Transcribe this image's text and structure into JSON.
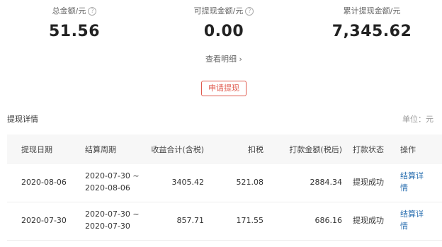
{
  "summary": {
    "total": {
      "label": "总金额/元",
      "value": "51.56"
    },
    "withdrawable": {
      "label": "可提现金额/元",
      "value": "0.00"
    },
    "cumulative": {
      "label": "累计提现金额/元",
      "value": "7,345.62"
    },
    "help_symbol": "?"
  },
  "detail_link": "查看明细 ›",
  "apply_button": "申请提现",
  "section": {
    "title": "提现详情",
    "unit": "单位：元"
  },
  "table": {
    "headers": [
      "提现日期",
      "结算周期",
      "收益合计(含税)",
      "扣税",
      "打款金额(税后)",
      "打款状态",
      "操作"
    ],
    "rows": [
      {
        "date": "2020-08-06",
        "period_start": "2020-07-30 ~",
        "period_end": "2020-08-06",
        "income": "3405.42",
        "tax": "521.08",
        "payout": "2884.34",
        "status": "提现成功",
        "action_l1": "结算详",
        "action_l2": "情"
      },
      {
        "date": "2020-07-30",
        "period_start": "2020-07-30 ~",
        "period_end": "2020-07-30",
        "income": "857.71",
        "tax": "171.55",
        "payout": "686.16",
        "status": "提现成功",
        "action_l1": "结算详",
        "action_l2": "情"
      }
    ]
  },
  "colors": {
    "accent": "#e05a4e",
    "link": "#2a6fb0",
    "header_bg": "#f7f7f7"
  }
}
